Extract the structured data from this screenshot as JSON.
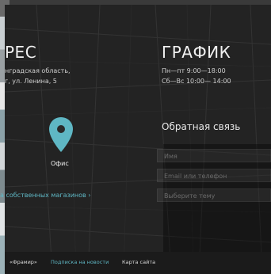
{
  "address": {
    "heading": "РЕС",
    "line1": "нградская область,",
    "line2": "г, ул. Ленина, 5"
  },
  "schedule": {
    "heading": "ГРАФИК",
    "weekdays": "Пн—пт 9:00—18:00",
    "weekend": "Сб—Вс 10:00— 14:00"
  },
  "map": {
    "pin_label": "Офис",
    "pin_color": "#5fb7c4"
  },
  "stores_link": "а собственных магазинов  ›",
  "feedback": {
    "title": "Обратная связь",
    "name_placeholder": "Имя",
    "contact_placeholder": "Email или телефон",
    "topic_placeholder": "Выберите тему"
  },
  "footer": {
    "brand": "«Фрамир»",
    "subscribe": "Подписка на новости",
    "sitemap": "Карта сайта"
  }
}
